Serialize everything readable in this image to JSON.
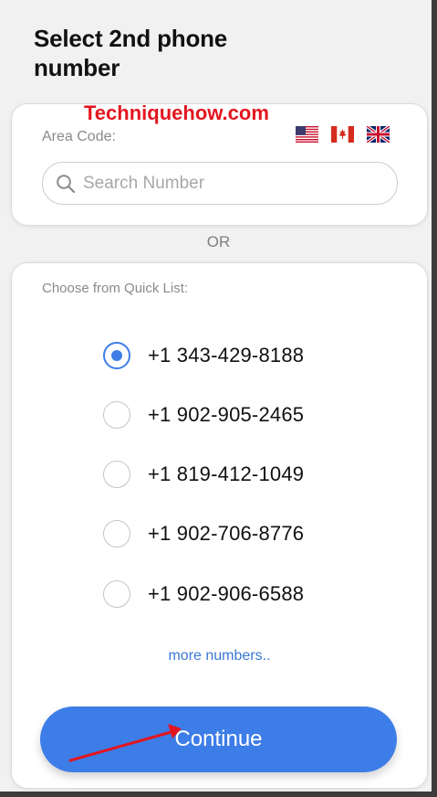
{
  "header": {
    "title": "Select 2nd phone number"
  },
  "watermark": "Techniquehow.com",
  "area_code": {
    "label": "Area Code:",
    "flags": [
      "us-flag-icon",
      "ca-flag-icon",
      "gb-flag-icon"
    ],
    "search": {
      "placeholder": "Search Number",
      "value": ""
    }
  },
  "separator": "OR",
  "quick_list": {
    "label": "Choose from Quick List:",
    "options": [
      {
        "number": "+1 343-429-8188",
        "selected": true
      },
      {
        "number": "+1 902-905-2465",
        "selected": false
      },
      {
        "number": "+1 819-412-1049",
        "selected": false
      },
      {
        "number": "+1 902-706-8776",
        "selected": false
      },
      {
        "number": "+1 902-906-6588",
        "selected": false
      }
    ],
    "more_label": "more numbers..",
    "continue_label": "Continue"
  },
  "colors": {
    "accent": "#3d7de8",
    "link": "#3a78d4",
    "watermark": "#e3161f",
    "arrow": "#e3161f"
  }
}
